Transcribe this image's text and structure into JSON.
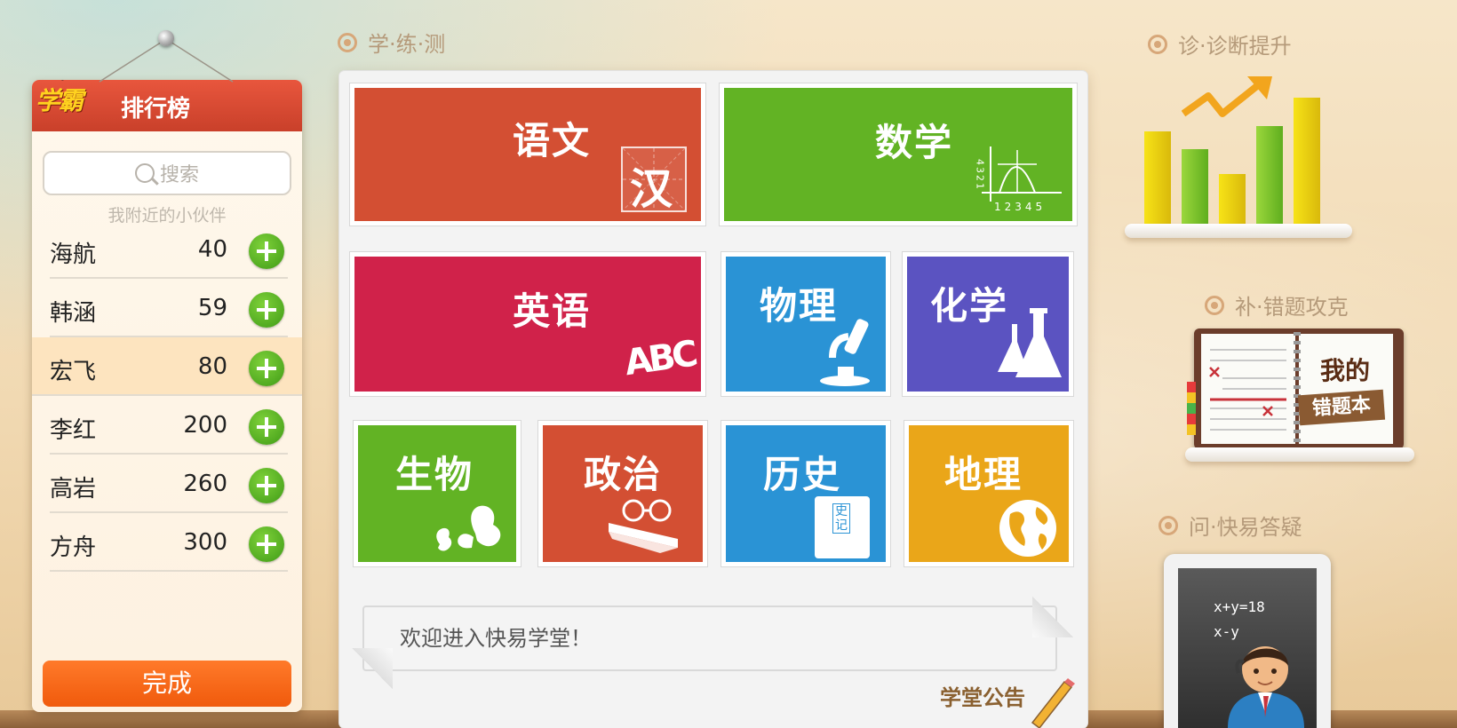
{
  "leaderboard": {
    "logo_text": "学霸",
    "title": "排行榜",
    "search_placeholder": "搜索",
    "nearby_label": "我附近的小伙伴",
    "rows": [
      {
        "name": "海航",
        "score": "40"
      },
      {
        "name": "韩涵",
        "score": "59"
      },
      {
        "name": "宏飞",
        "score": "80",
        "selected": true
      },
      {
        "name": "李红",
        "score": "200"
      },
      {
        "name": "高岩",
        "score": "260"
      },
      {
        "name": "方舟",
        "score": "300"
      }
    ],
    "done_label": "完成"
  },
  "sections": {
    "learn_practice_test": "学·练·测",
    "diagnose": "诊·诊断提升",
    "supplement": "补·错题攻克",
    "ask": "问·快易答疑"
  },
  "subjects": {
    "chinese": {
      "label": "语文",
      "icon_text": "汉",
      "color": "#d34f33"
    },
    "math": {
      "label": "数学",
      "color": "#62b324",
      "axis_x": "12345",
      "axis_y": "4321"
    },
    "english": {
      "label": "英语",
      "icon_text": "ABC",
      "color": "#d0224a"
    },
    "physics": {
      "label": "物理",
      "color": "#2a93d5"
    },
    "chemistry": {
      "label": "化学",
      "color": "#5b53c1"
    },
    "biology": {
      "label": "生物",
      "color": "#62b324"
    },
    "politics": {
      "label": "政治",
      "color": "#d34f33"
    },
    "history": {
      "label": "历史",
      "icon_text": "史记",
      "color": "#2a93d5"
    },
    "geography": {
      "label": "地理",
      "color": "#eaa619"
    }
  },
  "notice": {
    "welcome_text": "欢迎进入快易学堂！",
    "title": "学堂公告"
  },
  "mistake_book": {
    "title_line1": "我的",
    "title_line2": "错题本"
  },
  "qa_board": {
    "line1": "x+y=18",
    "line2": "x-y"
  }
}
